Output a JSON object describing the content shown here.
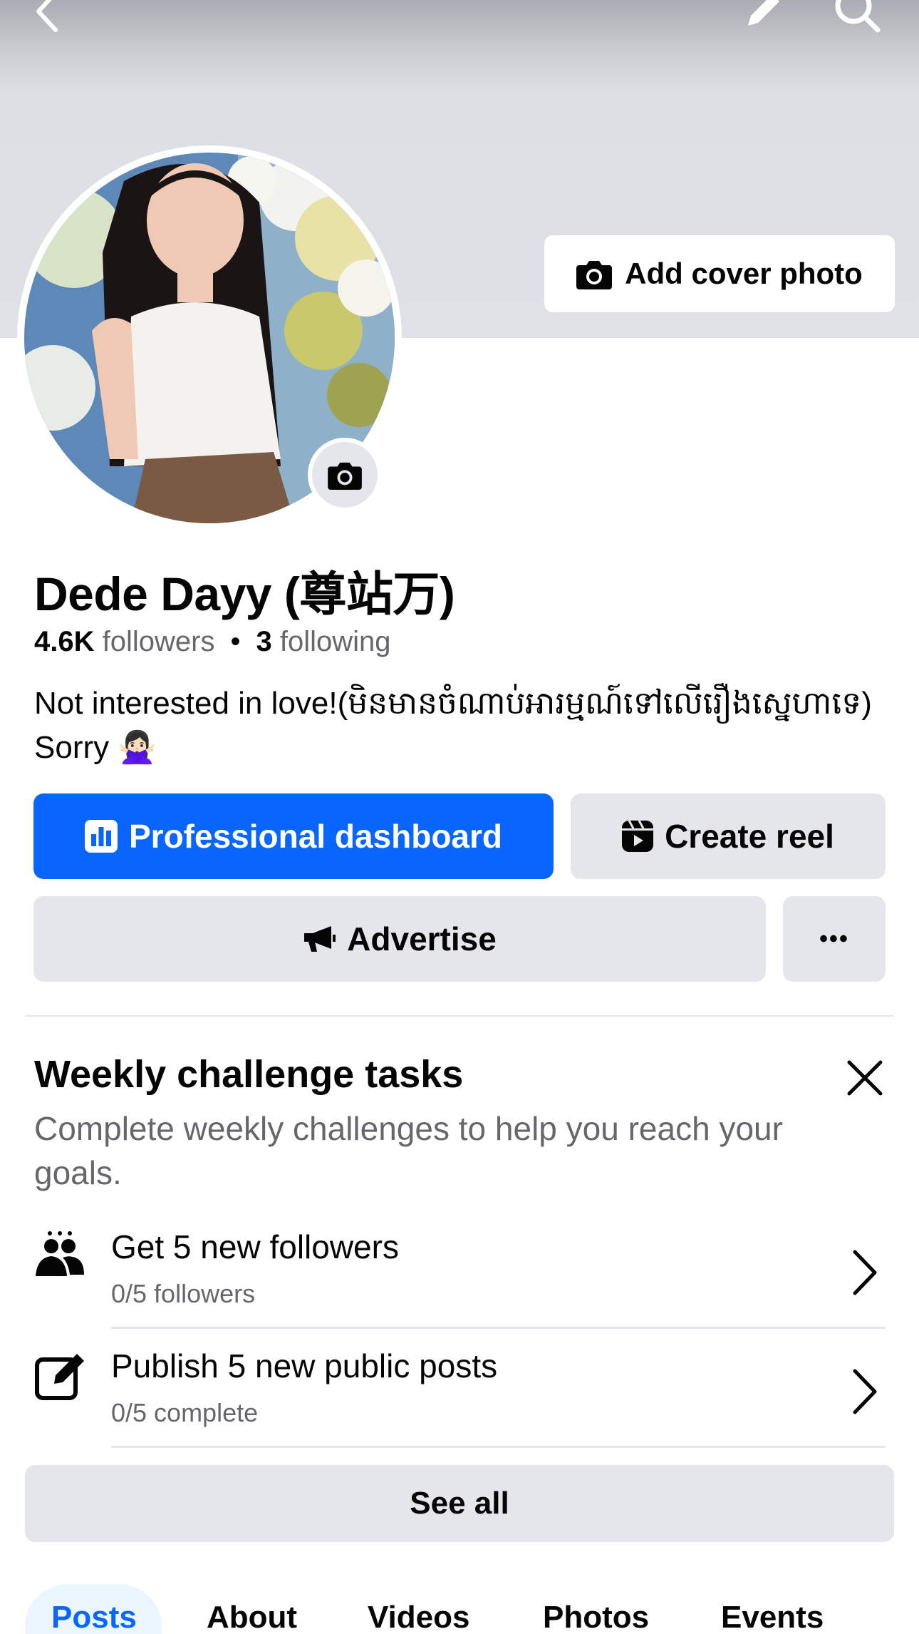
{
  "cover": {
    "add_cover_label": "Add cover photo"
  },
  "profile": {
    "name": "Dede Dayy (尊站万)",
    "followers_count": "4.6K",
    "followers_label": "followers",
    "separator": "•",
    "following_count": "3",
    "following_label": "following",
    "bio_text": "Not interested in love!(មិនមានចំណាប់អារម្មណ៍ទៅលើរឿងស្នេហាទេ) Sorry ",
    "bio_emoji": "🙅🏻‍♀️"
  },
  "actions": {
    "professional_dashboard": "Professional dashboard",
    "create_reel": "Create reel",
    "advertise": "Advertise",
    "more": "•••"
  },
  "weekly_challenge": {
    "title": "Weekly challenge tasks",
    "subtitle": "Complete weekly challenges to help you reach your goals.",
    "tasks": [
      {
        "title": "Get 5 new followers",
        "progress": "0/5 followers",
        "icon": "people-icon"
      },
      {
        "title": "Publish 5 new public posts",
        "progress": "0/5 complete",
        "icon": "compose-icon"
      }
    ],
    "see_all": "See all"
  },
  "tabs": [
    "Posts",
    "About",
    "Videos",
    "Photos",
    "Events"
  ],
  "colors": {
    "primary": "#0866ff",
    "button_gray": "#e4e6eb",
    "secondary_text": "#65676b",
    "active_tab_bg": "#ebf5ff"
  }
}
